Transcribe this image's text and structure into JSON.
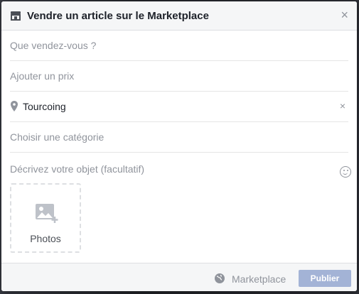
{
  "dialog": {
    "title": "Vendre un article sur le Marketplace",
    "close_icon": "×"
  },
  "form": {
    "what_placeholder": "Que vendez-vous ?",
    "price_placeholder": "Ajouter un prix",
    "location_value": "Tourcoing",
    "clear_icon": "×",
    "category_placeholder": "Choisir une catégorie",
    "description_placeholder": "Décrivez votre objet (facultatif)"
  },
  "photos": {
    "label": "Photos"
  },
  "footer": {
    "audience_label": "Marketplace",
    "publish_label": "Publier"
  },
  "colors": {
    "publish_disabled": "#a3b3d6",
    "header_bg": "#f5f6f7",
    "muted_text": "#90949c"
  }
}
